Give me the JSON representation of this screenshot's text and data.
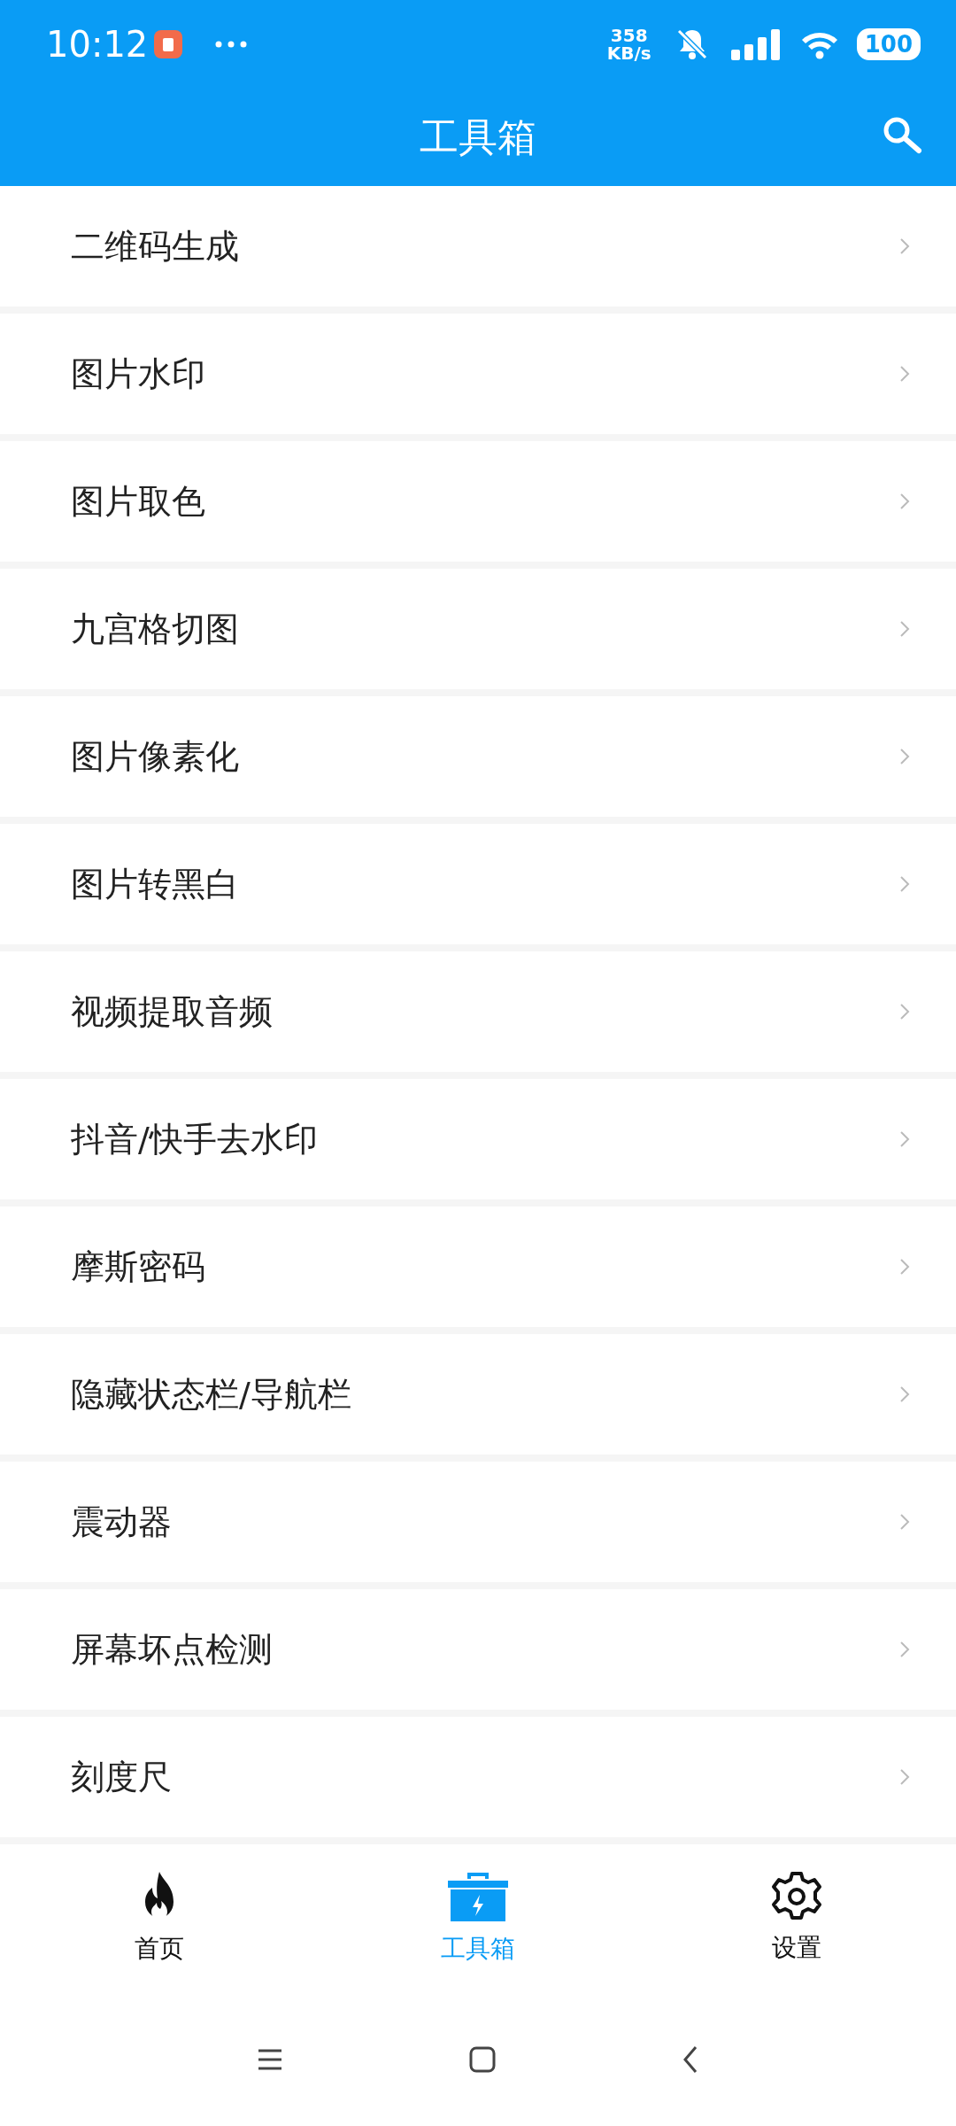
{
  "status_bar": {
    "time": "10:12",
    "net_speed_value": "358",
    "net_speed_unit": "KB/s",
    "battery": "100"
  },
  "app_bar": {
    "title": "工具箱"
  },
  "tools": [
    {
      "label": "二维码生成"
    },
    {
      "label": "图片水印"
    },
    {
      "label": "图片取色"
    },
    {
      "label": "九宫格切图"
    },
    {
      "label": "图片像素化"
    },
    {
      "label": "图片转黑白"
    },
    {
      "label": "视频提取音频"
    },
    {
      "label": "抖音/快手去水印"
    },
    {
      "label": "摩斯密码"
    },
    {
      "label": "隐藏状态栏/导航栏"
    },
    {
      "label": "震动器"
    },
    {
      "label": "屏幕坏点检测"
    },
    {
      "label": "刻度尺"
    }
  ],
  "bottom_nav": [
    {
      "label": "首页",
      "selected": false
    },
    {
      "label": "工具箱",
      "selected": true
    },
    {
      "label": "设置",
      "selected": false
    }
  ]
}
